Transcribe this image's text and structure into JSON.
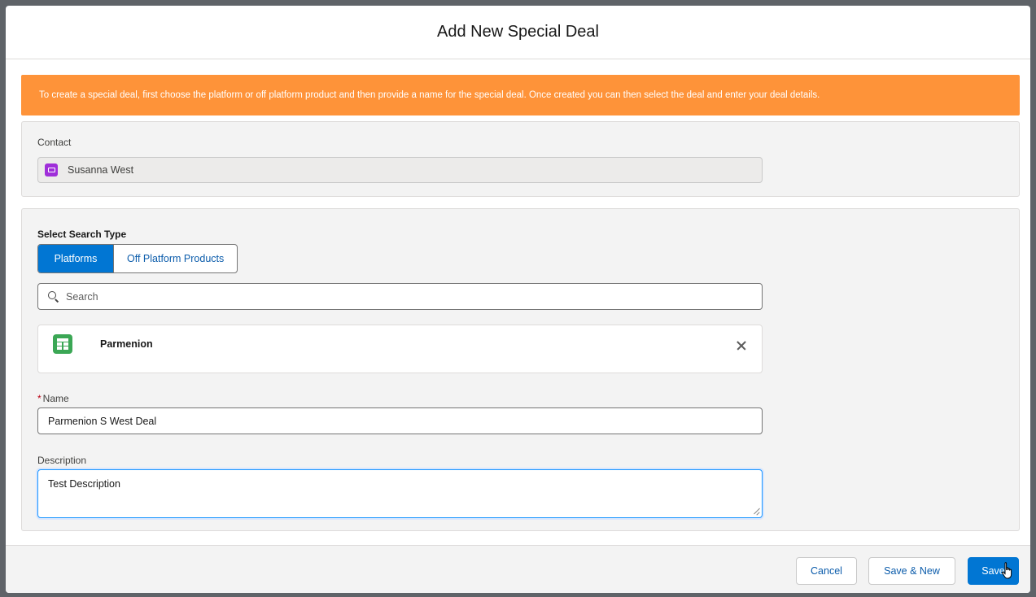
{
  "modal": {
    "title": "Add New Special Deal"
  },
  "banner": {
    "text": "To create a special deal, first choose the platform or off platform product and then provide a name for the special deal. Once created you can then select the deal and enter your deal details.",
    "color": "#fe9339"
  },
  "contact": {
    "label": "Contact",
    "value": "Susanna West",
    "icon": "contact-card-icon",
    "icon_color": "#9f2ed9"
  },
  "search_type": {
    "label": "Select Search Type",
    "options": [
      "Platforms",
      "Off Platform Products"
    ],
    "selected": "Platforms"
  },
  "search": {
    "placeholder": "Search",
    "icon": "search-icon"
  },
  "selected_platform": {
    "name": "Parmenion",
    "icon": "table-icon",
    "icon_color": "#3ba755"
  },
  "name_field": {
    "required_marker": "*",
    "label": "Name",
    "value": "Parmenion S West Deal"
  },
  "description_field": {
    "label": "Description",
    "value": "Test Description"
  },
  "footer": {
    "cancel_label": "Cancel",
    "save_new_label": "Save & New",
    "save_label": "Save"
  },
  "colors": {
    "brand": "#0176d3",
    "overlay": "#5f6368"
  }
}
